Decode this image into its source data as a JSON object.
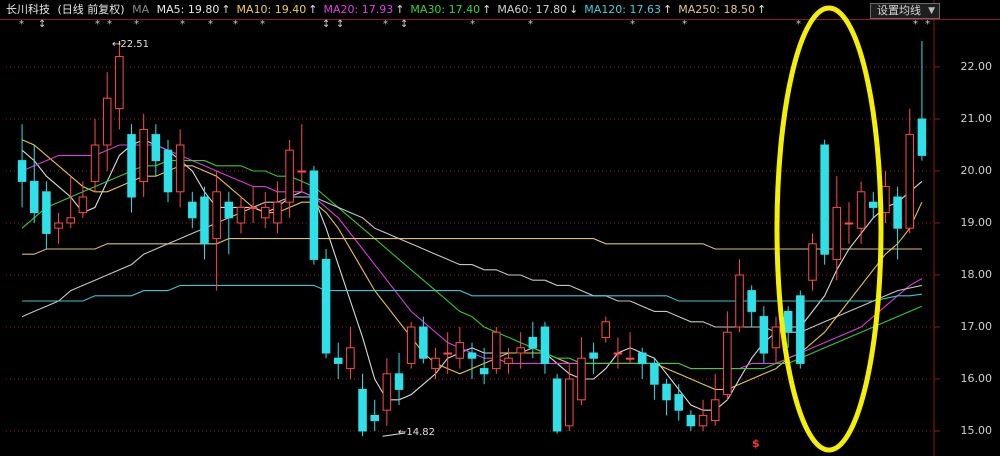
{
  "header": {
    "title": "长川科技",
    "mode": "(日线 前复权)",
    "ma_label": "MA",
    "indicators": [
      {
        "text": "MA5: 19.80",
        "arrow": "↑",
        "color": "#e6e6e6"
      },
      {
        "text": "MA10: 19.40",
        "arrow": "↑",
        "color": "#f2d04a"
      },
      {
        "text": "MA20: 17.93",
        "arrow": "↑",
        "color": "#e43ee4"
      },
      {
        "text": "MA30: 17.40",
        "arrow": "↑",
        "color": "#36d436"
      },
      {
        "text": "MA60: 17.80",
        "arrow": "↓",
        "color": "#d0d0d0"
      },
      {
        "text": "MA120: 17.63",
        "arrow": "↑",
        "color": "#3fd0e0"
      },
      {
        "text": "MA250: 18.50",
        "arrow": "↑",
        "color": "#e6c880"
      }
    ],
    "settings_button": "设置均线",
    "settings_arrow": "▼"
  },
  "star_row": {
    "star": "*",
    "arrow": "↕"
  },
  "annotations": {
    "high": "22.51",
    "low": "14.82",
    "signal": "$"
  },
  "colors": {
    "up": "#ff4a4a",
    "down": "#30e0e8",
    "highlight": "#f5f000",
    "grid": "#8b1a1a"
  },
  "chart_data": {
    "type": "candlestick",
    "ylim": [
      14.8,
      22.6
    ],
    "y_ticks": [
      "22.00",
      "21.00",
      "20.00",
      "19.00",
      "18.00",
      "17.00",
      "16.00",
      "15.00"
    ],
    "candles": [
      [
        20.2,
        19.8,
        20.9,
        19.3
      ],
      [
        19.8,
        19.2,
        20.5,
        19.0
      ],
      [
        19.6,
        18.8,
        19.8,
        18.5
      ],
      [
        18.9,
        19.0,
        19.2,
        18.6
      ],
      [
        19.0,
        19.1,
        19.9,
        18.9
      ],
      [
        19.2,
        19.5,
        19.8,
        19.1
      ],
      [
        19.8,
        20.5,
        21.0,
        19.6
      ],
      [
        20.5,
        21.4,
        21.9,
        20.0
      ],
      [
        21.2,
        22.2,
        22.5,
        20.8
      ],
      [
        20.7,
        19.5,
        20.9,
        19.2
      ],
      [
        19.8,
        20.8,
        21.1,
        19.5
      ],
      [
        20.7,
        20.2,
        20.9,
        19.9
      ],
      [
        20.4,
        19.6,
        20.6,
        19.4
      ],
      [
        19.6,
        20.5,
        20.8,
        19.3
      ],
      [
        19.4,
        19.1,
        19.6,
        18.9
      ],
      [
        19.5,
        18.6,
        19.7,
        18.3
      ],
      [
        18.7,
        19.6,
        20.0,
        17.7
      ],
      [
        19.4,
        19.1,
        19.6,
        18.4
      ],
      [
        19.0,
        19.3,
        19.5,
        18.8
      ],
      [
        19.3,
        19.3,
        19.7,
        19.0
      ],
      [
        19.1,
        19.3,
        19.6,
        18.9
      ],
      [
        19.0,
        19.4,
        19.8,
        18.8
      ],
      [
        19.4,
        20.4,
        20.6,
        19.1
      ],
      [
        20.0,
        20.0,
        20.9,
        19.6
      ],
      [
        20.0,
        18.3,
        20.1,
        18.2
      ],
      [
        18.3,
        16.5,
        18.5,
        16.4
      ],
      [
        16.4,
        16.3,
        16.7,
        16.0
      ],
      [
        16.2,
        16.6,
        17.0,
        16.0
      ],
      [
        15.8,
        15.0,
        16.1,
        14.9
      ],
      [
        15.3,
        15.2,
        15.6,
        15.0
      ],
      [
        15.4,
        16.1,
        16.4,
        15.1
      ],
      [
        16.1,
        15.8,
        16.5,
        15.5
      ],
      [
        16.3,
        17.0,
        17.1,
        16.2
      ],
      [
        17.0,
        16.4,
        17.2,
        16.3
      ],
      [
        16.2,
        16.4,
        16.6,
        16.0
      ],
      [
        16.5,
        16.5,
        16.9,
        16.1
      ],
      [
        16.4,
        16.7,
        17.0,
        16.2
      ],
      [
        16.5,
        16.4,
        16.7,
        16.0
      ],
      [
        16.2,
        16.1,
        16.6,
        15.9
      ],
      [
        16.2,
        16.9,
        17.0,
        16.1
      ],
      [
        16.3,
        16.4,
        16.6,
        16.1
      ],
      [
        16.5,
        16.6,
        16.9,
        16.2
      ],
      [
        16.8,
        16.6,
        17.1,
        16.4
      ],
      [
        17.0,
        16.3,
        17.1,
        16.1
      ],
      [
        16.0,
        15.0,
        16.1,
        14.95
      ],
      [
        15.1,
        16.0,
        16.3,
        15.0
      ],
      [
        15.6,
        16.4,
        16.8,
        15.5
      ],
      [
        16.5,
        16.4,
        16.7,
        16.1
      ],
      [
        16.8,
        17.1,
        17.2,
        16.7
      ],
      [
        16.5,
        16.5,
        16.8,
        16.2
      ],
      [
        16.4,
        16.4,
        16.9,
        16.3
      ],
      [
        16.5,
        16.3,
        16.6,
        16.0
      ],
      [
        16.3,
        15.9,
        16.4,
        15.6
      ],
      [
        15.9,
        15.6,
        16.0,
        15.3
      ],
      [
        15.7,
        15.4,
        15.9,
        15.2
      ],
      [
        15.3,
        15.1,
        15.4,
        15.0
      ],
      [
        15.1,
        15.3,
        15.6,
        15.0
      ],
      [
        15.2,
        15.6,
        16.1,
        15.1
      ],
      [
        15.7,
        16.9,
        17.3,
        15.6
      ],
      [
        17.0,
        18.0,
        18.3,
        16.9
      ],
      [
        17.7,
        17.3,
        17.8,
        17.0
      ],
      [
        17.2,
        16.5,
        17.4,
        16.3
      ],
      [
        16.6,
        17.0,
        17.2,
        16.3
      ],
      [
        17.3,
        16.9,
        17.4,
        16.6
      ],
      [
        17.6,
        16.3,
        17.7,
        16.2
      ],
      [
        17.9,
        18.6,
        18.8,
        17.7
      ],
      [
        20.5,
        18.4,
        20.6,
        18.2
      ],
      [
        18.3,
        19.3,
        19.9,
        17.9
      ],
      [
        19.0,
        19.0,
        19.4,
        18.6
      ],
      [
        18.9,
        19.6,
        19.8,
        18.6
      ],
      [
        19.4,
        19.3,
        19.6,
        19.1
      ],
      [
        19.2,
        19.7,
        20.0,
        19.0
      ],
      [
        19.5,
        18.9,
        19.7,
        18.3
      ],
      [
        18.9,
        20.7,
        21.2,
        18.8
      ],
      [
        21.0,
        20.3,
        22.5,
        20.2
      ]
    ],
    "ma_series": [
      {
        "name": "MA5",
        "color": "#e6e6e6",
        "points": [
          20.4,
          20.2,
          19.9,
          19.7,
          19.5,
          19.2,
          19.3,
          19.8,
          20.3,
          20.5,
          20.6,
          20.5,
          20.4,
          20.2,
          20.0,
          19.6,
          19.3,
          19.3,
          19.3,
          19.3,
          19.2,
          19.3,
          19.5,
          19.6,
          19.5,
          18.9,
          18.2,
          17.5,
          16.8,
          16.0,
          15.6,
          15.6,
          15.7,
          15.9,
          16.1,
          16.4,
          16.5,
          16.6,
          16.5,
          16.5,
          16.5,
          16.5,
          16.6,
          16.5,
          16.3,
          16.1,
          16.0,
          16.0,
          16.2,
          16.5,
          16.6,
          16.5,
          16.4,
          16.1,
          15.8,
          15.5,
          15.4,
          15.4,
          15.6,
          16.0,
          16.4,
          16.7,
          16.9,
          17.0,
          17.0,
          17.3,
          17.6,
          18.1,
          18.5,
          18.8,
          19.1,
          19.3,
          19.4,
          19.6,
          19.8
        ]
      },
      {
        "name": "MA10",
        "color": "#f2d04a",
        "points": [
          20.6,
          20.5,
          20.3,
          20.1,
          19.9,
          19.7,
          19.6,
          19.6,
          19.7,
          19.8,
          19.9,
          19.9,
          20.0,
          20.1,
          20.1,
          20.0,
          19.9,
          19.7,
          19.5,
          19.3,
          19.2,
          19.2,
          19.3,
          19.4,
          19.4,
          19.2,
          18.9,
          18.5,
          18.1,
          17.7,
          17.4,
          17.1,
          16.8,
          16.5,
          16.3,
          16.2,
          16.1,
          16.2,
          16.3,
          16.4,
          16.5,
          16.5,
          16.5,
          16.5,
          16.4,
          16.3,
          16.3,
          16.3,
          16.3,
          16.3,
          16.3,
          16.3,
          16.3,
          16.2,
          16.1,
          16.0,
          15.9,
          15.8,
          15.8,
          15.9,
          16.0,
          16.1,
          16.2,
          16.4,
          16.5,
          16.7,
          16.9,
          17.2,
          17.5,
          17.8,
          18.1,
          18.4,
          18.6,
          18.9,
          19.4
        ]
      },
      {
        "name": "MA20",
        "color": "#e43ee4",
        "points": [
          20.0,
          20.1,
          20.2,
          20.3,
          20.3,
          20.3,
          20.3,
          20.4,
          20.5,
          20.5,
          20.5,
          20.5,
          20.4,
          20.3,
          20.2,
          20.1,
          20.0,
          19.9,
          19.8,
          19.7,
          19.7,
          19.6,
          19.6,
          19.6,
          19.5,
          19.3,
          19.1,
          18.8,
          18.5,
          18.2,
          17.9,
          17.6,
          17.3,
          17.1,
          16.9,
          16.7,
          16.6,
          16.5,
          16.4,
          16.4,
          16.3,
          16.3,
          16.3,
          16.3,
          16.3,
          16.3,
          16.3,
          16.3,
          16.3,
          16.3,
          16.3,
          16.3,
          16.3,
          16.3,
          16.3,
          16.2,
          16.2,
          16.2,
          16.2,
          16.2,
          16.3,
          16.3,
          16.3,
          16.4,
          16.5,
          16.6,
          16.7,
          16.8,
          16.9,
          17.0,
          17.2,
          17.4,
          17.6,
          17.8,
          17.93
        ]
      },
      {
        "name": "MA30",
        "color": "#36d436",
        "points": [
          18.9,
          19.1,
          19.3,
          19.4,
          19.5,
          19.6,
          19.7,
          19.8,
          19.9,
          20.0,
          20.1,
          20.1,
          20.2,
          20.2,
          20.2,
          20.2,
          20.1,
          20.1,
          20.1,
          20.0,
          20.0,
          19.9,
          19.9,
          19.8,
          19.7,
          19.5,
          19.3,
          19.1,
          18.9,
          18.7,
          18.5,
          18.3,
          18.1,
          17.9,
          17.7,
          17.5,
          17.3,
          17.2,
          17.0,
          16.9,
          16.8,
          16.7,
          16.6,
          16.5,
          16.4,
          16.4,
          16.3,
          16.3,
          16.3,
          16.3,
          16.3,
          16.3,
          16.3,
          16.3,
          16.3,
          16.2,
          16.2,
          16.2,
          16.2,
          16.2,
          16.2,
          16.2,
          16.3,
          16.3,
          16.4,
          16.5,
          16.6,
          16.7,
          16.8,
          16.9,
          17.0,
          17.1,
          17.2,
          17.3,
          17.4
        ]
      },
      {
        "name": "MA60",
        "color": "#d0d0d0",
        "points": [
          17.2,
          17.3,
          17.4,
          17.5,
          17.7,
          17.8,
          17.9,
          18.0,
          18.1,
          18.2,
          18.4,
          18.5,
          18.6,
          18.7,
          18.8,
          18.9,
          19.0,
          19.1,
          19.2,
          19.3,
          19.4,
          19.4,
          19.5,
          19.5,
          19.5,
          19.4,
          19.3,
          19.2,
          19.1,
          18.9,
          18.8,
          18.7,
          18.6,
          18.5,
          18.4,
          18.3,
          18.2,
          18.2,
          18.1,
          18.1,
          18.0,
          18.0,
          17.9,
          17.9,
          17.8,
          17.8,
          17.7,
          17.6,
          17.6,
          17.5,
          17.5,
          17.4,
          17.3,
          17.3,
          17.2,
          17.1,
          17.1,
          17.0,
          17.0,
          17.0,
          17.0,
          17.0,
          16.9,
          16.9,
          16.9,
          17.0,
          17.1,
          17.2,
          17.3,
          17.4,
          17.5,
          17.6,
          17.7,
          17.75,
          17.8
        ]
      },
      {
        "name": "MA120",
        "color": "#3fd0e0",
        "points": [
          17.5,
          17.5,
          17.5,
          17.5,
          17.5,
          17.5,
          17.6,
          17.6,
          17.6,
          17.6,
          17.7,
          17.7,
          17.7,
          17.8,
          17.8,
          17.8,
          17.8,
          17.8,
          17.8,
          17.8,
          17.8,
          17.8,
          17.8,
          17.8,
          17.8,
          17.7,
          17.7,
          17.7,
          17.7,
          17.7,
          17.7,
          17.7,
          17.7,
          17.7,
          17.7,
          17.7,
          17.7,
          17.6,
          17.6,
          17.6,
          17.6,
          17.6,
          17.6,
          17.6,
          17.6,
          17.6,
          17.6,
          17.6,
          17.6,
          17.6,
          17.6,
          17.6,
          17.6,
          17.6,
          17.5,
          17.5,
          17.5,
          17.5,
          17.5,
          17.5,
          17.5,
          17.5,
          17.5,
          17.5,
          17.5,
          17.5,
          17.5,
          17.5,
          17.5,
          17.5,
          17.5,
          17.55,
          17.6,
          17.6,
          17.63
        ]
      },
      {
        "name": "MA250",
        "color": "#e6c880",
        "points": [
          18.4,
          18.4,
          18.5,
          18.5,
          18.5,
          18.5,
          18.5,
          18.6,
          18.6,
          18.6,
          18.6,
          18.6,
          18.6,
          18.6,
          18.6,
          18.6,
          18.6,
          18.7,
          18.7,
          18.7,
          18.7,
          18.7,
          18.7,
          18.7,
          18.7,
          18.7,
          18.7,
          18.7,
          18.7,
          18.7,
          18.7,
          18.7,
          18.7,
          18.7,
          18.7,
          18.7,
          18.7,
          18.7,
          18.7,
          18.7,
          18.7,
          18.7,
          18.7,
          18.7,
          18.7,
          18.7,
          18.7,
          18.7,
          18.6,
          18.6,
          18.6,
          18.6,
          18.6,
          18.6,
          18.6,
          18.6,
          18.6,
          18.5,
          18.5,
          18.5,
          18.5,
          18.5,
          18.5,
          18.5,
          18.5,
          18.5,
          18.5,
          18.5,
          18.5,
          18.5,
          18.5,
          18.5,
          18.5,
          18.5,
          18.5
        ]
      }
    ]
  }
}
